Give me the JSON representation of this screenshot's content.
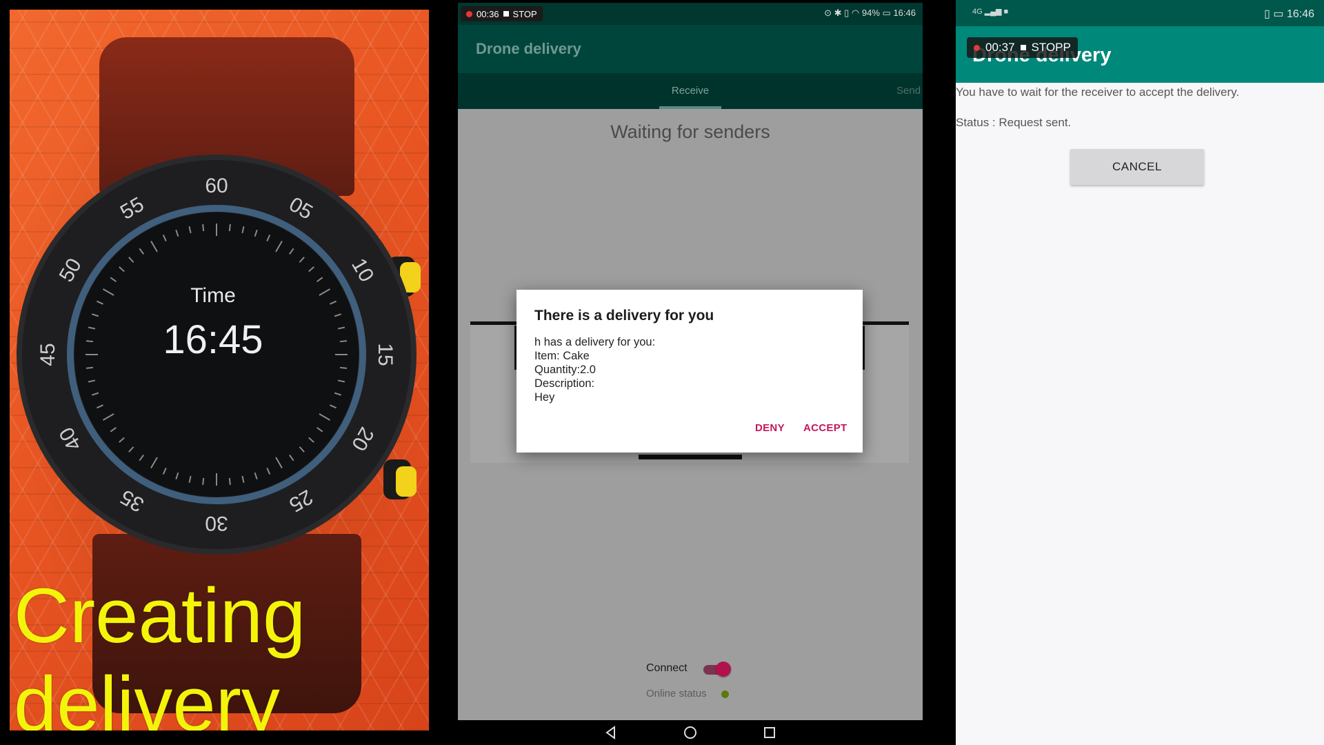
{
  "watch_panel": {
    "time_label": "Time",
    "time_value": "16:45",
    "bezel_numbers": [
      "60",
      "05",
      "10",
      "15",
      "20",
      "25",
      "30",
      "35",
      "40",
      "45",
      "50",
      "55"
    ],
    "caption_line1": "Creating",
    "caption_line2": "delivery"
  },
  "receiver_phone": {
    "status_bar": {
      "recording_time": "00:36",
      "stop_label": "STOP",
      "battery": "94%",
      "clock": "16:46"
    },
    "app_title": "Drone delivery",
    "tabs": [
      {
        "label": "Receive",
        "selected": true
      },
      {
        "label": "Send",
        "selected": false
      }
    ],
    "waiting_text": "Waiting for senders",
    "dialog": {
      "title": "There is a delivery for you",
      "body_lines": [
        "h has a delivery for you:",
        "Item: Cake",
        "Quantity:2.0",
        "Description:",
        "Hey"
      ],
      "deny_label": "DENY",
      "accept_label": "ACCEPT"
    },
    "connect_label": "Connect",
    "connect_on": true,
    "online_status_label": "Online status",
    "colors": {
      "accent": "#c2185b",
      "online": "#5b7a0a",
      "appbar": "#00453b"
    },
    "nav_icons": [
      "back-icon",
      "home-icon",
      "recents-icon"
    ]
  },
  "sender_phone": {
    "status_bar": {
      "network": "4G",
      "clock": "16:46"
    },
    "recording_overlay": {
      "time": "00:37",
      "stop_label": "STOPP"
    },
    "app_title": "Drone delivery",
    "message": "You have to wait for the receiver to accept the delivery.",
    "status_text": "Status : Request sent.",
    "cancel_label": "CANCEL",
    "colors": {
      "appbar": "#00887a",
      "statusbar": "#00574b"
    }
  }
}
